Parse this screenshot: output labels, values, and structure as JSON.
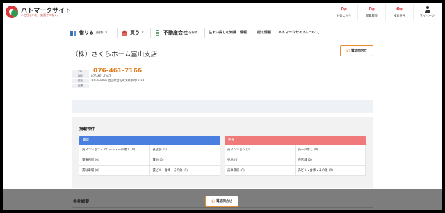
{
  "header": {
    "site_name": "ハトマークサイト",
    "tagline": "人と住まいを、笑顔でつなぐ。",
    "favorites": {
      "count": "0",
      "unit": "件",
      "label": "お気に入り"
    },
    "history": {
      "count": "0",
      "unit": "件",
      "label": "閲覧履歴"
    },
    "search_conditions": {
      "count": "0",
      "unit": "件",
      "label": "検索条件"
    },
    "mypage_label": "マイページ"
  },
  "nav": {
    "rent": {
      "label": "借りる",
      "sub": "(賃貸)"
    },
    "buy": {
      "label": "買う"
    },
    "company": {
      "label": "不動産会社",
      "sub": "を探す"
    },
    "links": [
      "住まい探しの知識・情報",
      "街の情報",
      "ハトマークサイトについて"
    ]
  },
  "company": {
    "name": "（株）さくらホーム富山支店",
    "tel_button": "電話問合せ",
    "tel_tag": "TEL",
    "tel": "076-461-7166",
    "fax_tag": "FAX",
    "fax": "076-461-7167",
    "address_tag": "住所",
    "address": "〒939-8095 富山県富山市大泉中町12-33",
    "access_tag": "交通",
    "access": ""
  },
  "listings": {
    "title": "掲載物件",
    "rent": {
      "header": "賃貸",
      "items": [
        "賃マンション・アパート・一戸建て (0)",
        "賃店舗 (0)",
        "賃事務所 (0)",
        "賃地 (0)",
        "賃駐車場 (0)",
        "賃ビル・倉庫・その他 (0)"
      ]
    },
    "sale": {
      "header": "売買",
      "items": [
        "売マンション (0)",
        "売一戸建て (0)",
        "売地 (0)",
        "売店舗 (0)",
        "売事務所 (0)",
        "売ビル・倉庫・その他 (0)"
      ]
    }
  },
  "outline": {
    "title": "会社概要"
  },
  "sticky": {
    "tel_button": "電話問合せ"
  },
  "colors": {
    "brand_red": "#d8393c",
    "accent_orange": "#e07d1f",
    "rent_blue": "#4a7fe0",
    "sale_red": "#f07a7a"
  }
}
